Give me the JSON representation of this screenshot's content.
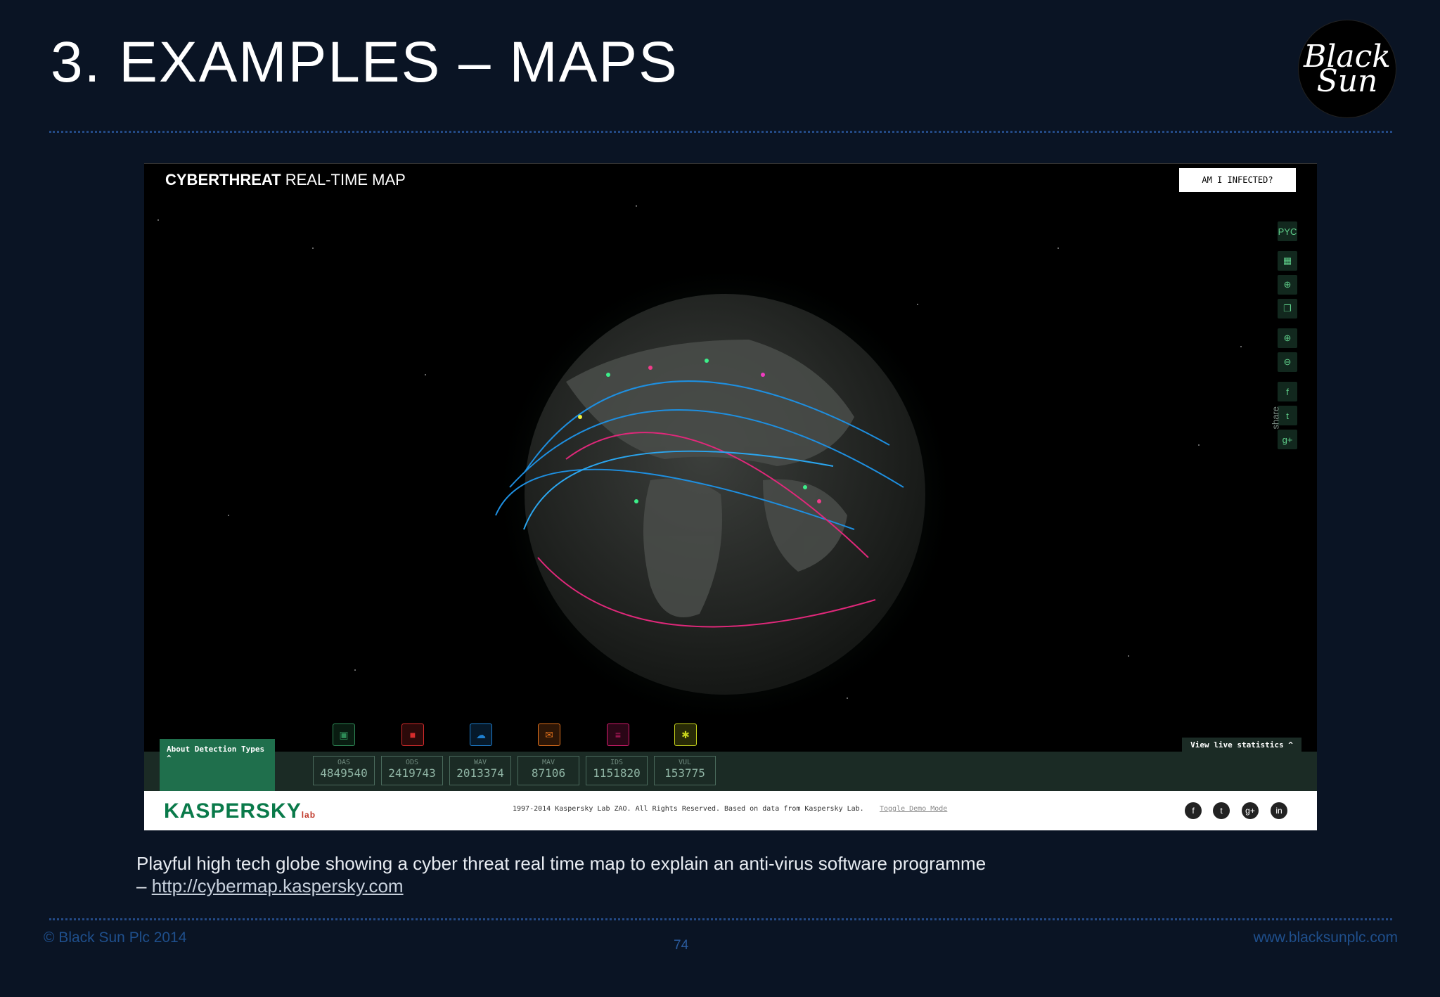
{
  "slide": {
    "title_num": "3.",
    "title_text": "EXAMPLES – MAPS",
    "logo_text": "Black Sun"
  },
  "screenshot": {
    "title_bold": "CYBERTHREAT",
    "title_rest": " REAL-TIME MAP",
    "infected_button": "AM I INFECTED?",
    "tools": [
      {
        "name": "language-icon",
        "glyph": "PYC"
      },
      {
        "name": "grid-icon",
        "glyph": "▦"
      },
      {
        "name": "globe-icon",
        "glyph": "⊕"
      },
      {
        "name": "layers-icon",
        "glyph": "❐"
      },
      {
        "name": "zoom-in-icon",
        "glyph": "⊕"
      },
      {
        "name": "zoom-out-icon",
        "glyph": "⊖"
      },
      {
        "name": "facebook-icon",
        "glyph": "f"
      },
      {
        "name": "twitter-icon",
        "glyph": "t"
      },
      {
        "name": "google-plus-icon",
        "glyph": "g+"
      }
    ],
    "share_label": "share",
    "about_tab": "About Detection Types ^",
    "live_stats": "View live statistics ^",
    "detections": [
      {
        "code": "OAS",
        "value": "4849540",
        "color": "#2e8b57",
        "icon": "floppy-icon",
        "glyph": "▣"
      },
      {
        "code": "ODS",
        "value": "2419743",
        "color": "#d62c2c",
        "icon": "folder-icon",
        "glyph": "■"
      },
      {
        "code": "WAV",
        "value": "2013374",
        "color": "#1e7fd0",
        "icon": "cloud-icon",
        "glyph": "☁"
      },
      {
        "code": "MAV",
        "value": "87106",
        "color": "#e0701c",
        "icon": "mail-icon",
        "glyph": "✉"
      },
      {
        "code": "IDS",
        "value": "1151820",
        "color": "#d41c6c",
        "icon": "ids-icon",
        "glyph": "≡"
      },
      {
        "code": "VUL",
        "value": "153775",
        "color": "#c8d41c",
        "icon": "bug-icon",
        "glyph": "✱"
      }
    ],
    "kaspersky_logo": "KASPERSKY",
    "kaspersky_lab": "lab",
    "copyright": "1997-2014 Kaspersky Lab ZAO. All Rights Reserved. Based on data from Kaspersky Lab.",
    "toggle_demo": "Toggle Demo Mode",
    "social": [
      {
        "name": "facebook-icon",
        "glyph": "f"
      },
      {
        "name": "twitter-icon",
        "glyph": "t"
      },
      {
        "name": "google-plus-icon",
        "glyph": "g+"
      },
      {
        "name": "linkedin-icon",
        "glyph": "in"
      }
    ]
  },
  "caption": {
    "line1": "Playful high tech globe showing a cyber threat real time map to explain an anti-virus software programme",
    "dash": "– ",
    "link": "http://cybermap.kaspersky.com"
  },
  "footer": {
    "left": "© Black Sun Plc 2014",
    "page": "74",
    "right": "www.blacksunplc.com"
  }
}
